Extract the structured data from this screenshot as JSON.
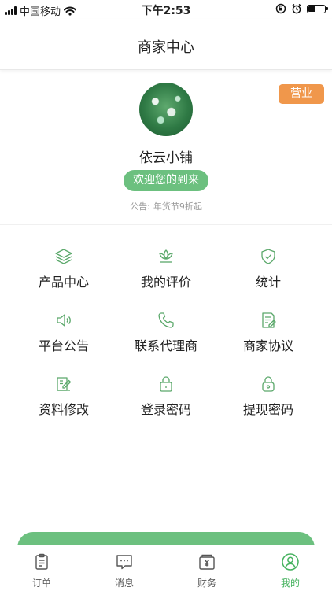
{
  "status_bar": {
    "carrier": "中国移动",
    "time": "下午2:53"
  },
  "header": {
    "title": "商家中心"
  },
  "shop": {
    "status_tag": "营业",
    "name": "依云小铺",
    "welcome_label": "欢迎您的到来",
    "notice_label": "公告:",
    "notice_text": "年货节9折起"
  },
  "menu": [
    {
      "label": "产品中心",
      "icon": "layers-icon"
    },
    {
      "label": "我的评价",
      "icon": "lotus-icon"
    },
    {
      "label": "统计",
      "icon": "shield-check-icon"
    },
    {
      "label": "平台公告",
      "icon": "speaker-icon"
    },
    {
      "label": "联系代理商",
      "icon": "phone-icon"
    },
    {
      "label": "商家协议",
      "icon": "document-icon"
    },
    {
      "label": "资料修改",
      "icon": "edit-icon"
    },
    {
      "label": "登录密码",
      "icon": "lock-icon"
    },
    {
      "label": "提现密码",
      "icon": "lock-icon"
    }
  ],
  "tabbar": [
    {
      "label": "订单",
      "icon": "clipboard-icon"
    },
    {
      "label": "消息",
      "icon": "chat-icon"
    },
    {
      "label": "财务",
      "icon": "wallet-icon"
    },
    {
      "label": "我的",
      "icon": "user-icon",
      "active": true
    }
  ],
  "colors": {
    "accent": "#6cc07f",
    "active_tab": "#46b25f",
    "status_tag": "#f0974b",
    "icon_green": "#5aa86a"
  }
}
